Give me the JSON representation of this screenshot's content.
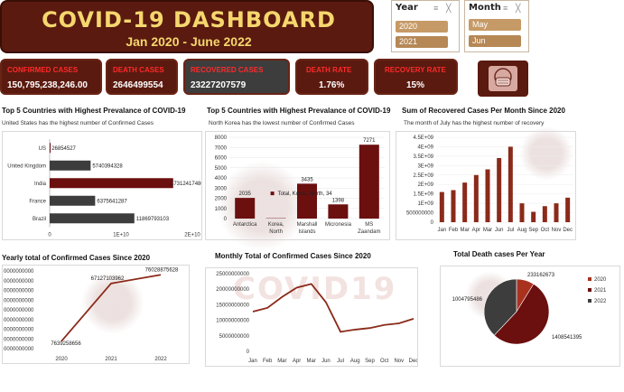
{
  "header": {
    "title": "COVID-19 DASHBOARD",
    "subtitle": "Jan 2020 - June 2022"
  },
  "slicers": {
    "year": {
      "label": "Year",
      "items": [
        "2020",
        "2021"
      ]
    },
    "month": {
      "label": "Month",
      "items": [
        "May",
        "Jun"
      ]
    }
  },
  "kpis": [
    {
      "label": "CONFIRMED CASES",
      "value": "150,795,238,246.00"
    },
    {
      "label": "DEATH CASES",
      "value": "2646499554"
    },
    {
      "label": "RECOVERED CASES",
      "value": "23227207579"
    },
    {
      "label": "DEATH RATE",
      "value": "1.76%"
    },
    {
      "label": "RECOVERY RATE",
      "value": "15%"
    }
  ],
  "mask_icon": "face-mask-icon",
  "watermark": "COVID19",
  "colors": {
    "brand_dark": "#5a1a0f",
    "bar_red": "#6b0f0f",
    "bar_gray": "#3d3d3d",
    "line_brown": "#8b2a1a",
    "kpi_label": "#ff2a2a",
    "title_gold": "#f5d76e"
  },
  "sections": {
    "top5": {
      "title": "Top 5 Countries with Highest Prevalance of COVID-19",
      "subtitle": "United States has the highest number of Confirmed Cases"
    },
    "lowest5": {
      "title": "Top 5 Countries with Highest Prevalance of COVID-19",
      "subtitle": "North Korea has the lowest number of Confirmed Cases"
    },
    "recovered": {
      "title": "Sum of Recovered Cases Per Month Since 2020",
      "subtitle": "The month of July has the highest number of recovery"
    },
    "yearly": {
      "title": "Yearly total of Confirmed Cases Since 2020"
    },
    "monthly": {
      "title": "Monthly Total of Confirmed Cases Since 2020"
    },
    "deaths": {
      "title": "Total Death cases Per Year"
    }
  },
  "chart_data": [
    {
      "type": "bar",
      "orientation": "horizontal",
      "categories": [
        "US",
        "United Kingdom",
        "India",
        "France",
        "Brazil"
      ],
      "values": [
        26854527,
        5740394328,
        17312417486,
        6375641287,
        11869793103
      ],
      "labels": [
        "26854527",
        "5740394328",
        "17312417486",
        "6375641287",
        "11869793103"
      ],
      "x_ticks": [
        "0",
        "1E+10",
        "2E+10"
      ],
      "xlim": [
        0,
        20000000000
      ],
      "bar_colors": [
        "#6b0f0f",
        "#3d3d3d",
        "#6b0f0f",
        "#3d3d3d",
        "#3d3d3d"
      ]
    },
    {
      "type": "bar",
      "categories": [
        "Antarctica",
        "Korea, North",
        "Marshall Islands",
        "Micronesia",
        "MS Zaandam"
      ],
      "values": [
        2035,
        34,
        3435,
        1398,
        7271
      ],
      "labels": [
        "2035",
        "",
        "3435",
        "1398",
        "7271"
      ],
      "y_ticks": [
        "0",
        "1000",
        "2000",
        "3000",
        "4000",
        "5000",
        "6000",
        "7000",
        "8000"
      ],
      "ylim": [
        0,
        8000
      ],
      "tooltip": "Total, Korea, North, 34"
    },
    {
      "type": "bar",
      "categories": [
        "Jan",
        "Feb",
        "Mar",
        "Apr",
        "Mar",
        "Jun",
        "Jul",
        "Aug",
        "Sep",
        "Oct",
        "Nov",
        "Dec"
      ],
      "values": [
        1600000000,
        1700000000,
        2100000000,
        2500000000,
        2800000000,
        3400000000,
        4000000000,
        1000000000,
        550000000,
        850000000,
        1000000000,
        1300000000
      ],
      "y_ticks": [
        "0",
        "500000000",
        "1E+09",
        "1.5E+09",
        "2E+09",
        "2.5E+09",
        "3E+09",
        "3.5E+09",
        "4E+09",
        "4.5E+09"
      ],
      "ylim": [
        0,
        4500000000
      ]
    },
    {
      "type": "line",
      "x": [
        "2020",
        "2021",
        "2022"
      ],
      "values": [
        7639258656,
        67127103962,
        76028875628
      ],
      "labels": [
        "7639258656",
        "67127103962",
        "76028875628"
      ],
      "y_ticks": [
        "0000000000",
        "0000000000",
        "0000000000",
        "0000000000",
        "0000000000",
        "0000000000",
        "0000000000",
        "0000000000",
        "0000000000"
      ],
      "ylim": [
        0,
        80000000000
      ]
    },
    {
      "type": "line",
      "x": [
        "Jan",
        "Feb",
        "Mar",
        "Apr",
        "Mar",
        "Jun",
        "Jul",
        "Aug",
        "Sep",
        "Oct",
        "Nov",
        "Dec"
      ],
      "values": [
        12800000000,
        14000000000,
        17500000000,
        20500000000,
        21700000000,
        15800000000,
        6300000000,
        7000000000,
        7500000000,
        8500000000,
        9000000000,
        10500000000
      ],
      "y_ticks": [
        "0",
        "5000000000",
        "10000000000",
        "15000000000",
        "20000000000",
        "25000000000"
      ],
      "ylim": [
        0,
        25000000000
      ]
    },
    {
      "type": "pie",
      "categories": [
        "2020",
        "2021",
        "2022"
      ],
      "values": [
        233162673,
        1408541395,
        1004795486
      ],
      "labels": [
        "233162673",
        "1408541395",
        "1004795486"
      ],
      "colors": [
        "#a8321e",
        "#6b0f0f",
        "#3d3d3d"
      ]
    }
  ]
}
